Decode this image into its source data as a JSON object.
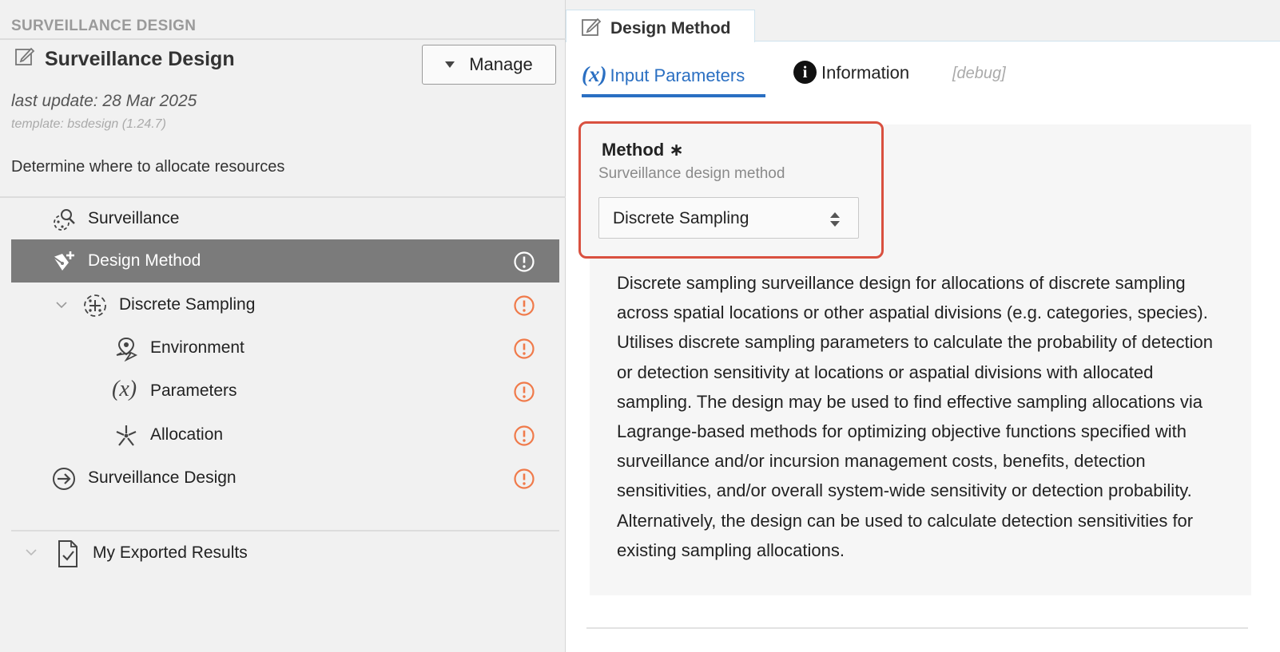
{
  "left": {
    "section_title": "SURVEILLANCE DESIGN",
    "project_title": "Surveillance Design",
    "manage_label": "Manage",
    "last_update": "last update: 28 Mar 2025",
    "template": "template: bsdesign (1.24.7)",
    "description": "Determine where to allocate resources",
    "tree": [
      {
        "label": "Surveillance",
        "icon": "surveillance-icon"
      },
      {
        "label": "Design Method",
        "icon": "design-method-icon",
        "selected": true,
        "status": "warning-icon"
      },
      {
        "label": "Discrete Sampling",
        "icon": "discrete-sampling-icon",
        "expanded": true,
        "status": "warning-icon"
      },
      {
        "label": "Environment",
        "icon": "environment-icon",
        "status": "warning-icon"
      },
      {
        "label": "Parameters",
        "icon": "parameters-icon",
        "status": "warning-icon"
      },
      {
        "label": "Allocation",
        "icon": "allocation-icon",
        "status": "warning-icon"
      },
      {
        "label": "Surveillance Design",
        "icon": "arrow-right-circle-icon",
        "status": "warning-icon"
      },
      {
        "label": "My Exported Results",
        "icon": "exported-results-icon",
        "expanded": false
      }
    ]
  },
  "right": {
    "doc_tab_label": "Design Method",
    "subtabs": {
      "input_fx": "(x)",
      "input_label": "Input Parameters",
      "info_glyph": "i",
      "info_label": "Information",
      "debug_label": "[debug]"
    },
    "method": {
      "label": "Method",
      "required_mark": "∗",
      "hint": "Surveillance design method",
      "selected_value": "Discrete Sampling",
      "text": "Discrete sampling surveillance design for allocations of discrete sampling across spatial locations or other aspatial divisions (e.g. categories, species). Utilises discrete sampling parameters to calculate the probability of detection or detection sensitivity at locations or aspatial divisions with allocated sampling. The design may be used to find effective sampling allocations via Lagrange-based methods for optimizing objective functions specified with surveillance and/or incursion management costs, benefits, detection sensitivities, and/or overall system-wide sensitivity or detection probability. Alternatively, the design can be used to calculate detection sensitivities for existing sampling allocations."
    }
  },
  "colors": {
    "accent_blue": "#2a6fc2",
    "warning_orange": "#f07a4a",
    "selected_row": "#7b7b7b",
    "highlight_red": "#d9503f"
  }
}
